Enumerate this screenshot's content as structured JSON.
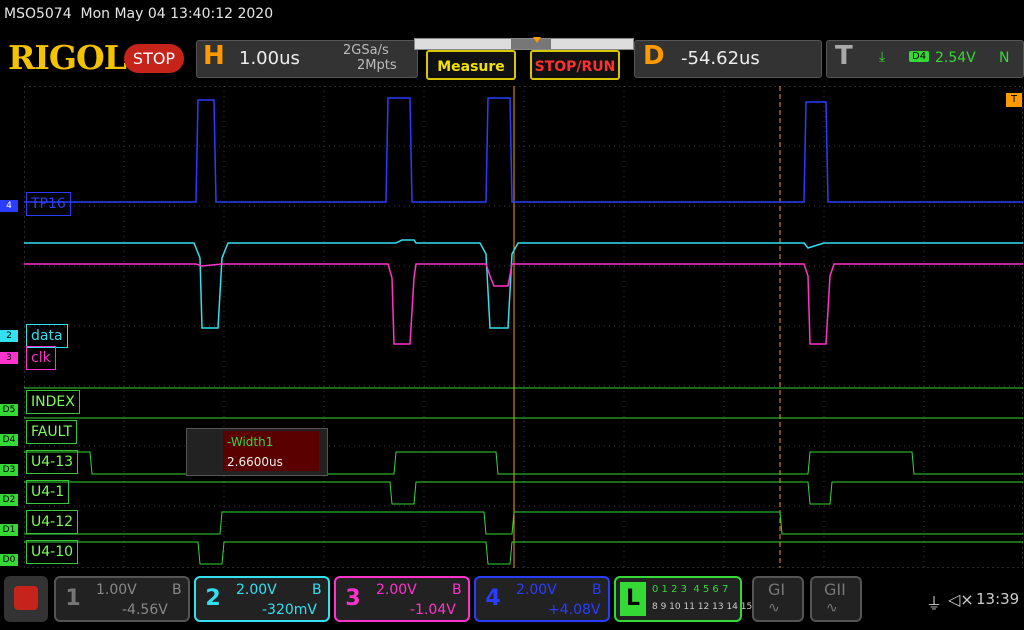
{
  "header": {
    "model_timestamp": "MSO5074  Mon May 04 13:40:12 2020",
    "logo": "RIGOL",
    "run_state": "STOP",
    "horizontal": {
      "letter": "H",
      "scale": "1.00us",
      "sample_rate": "2GSa/s",
      "memory": "2Mpts"
    },
    "measure_button": "Measure",
    "stoprun_button": "STOP/RUN",
    "delay": {
      "letter": "D",
      "value": "-54.62us"
    },
    "trigger": {
      "letter": "T",
      "source": "D4",
      "level": "2.54V",
      "mode": "N"
    }
  },
  "channel_labels": {
    "ch4": "TP16",
    "ch2": "data",
    "ch3": "clk",
    "d5": "INDEX",
    "d4": "FAULT",
    "d3": "U4-13",
    "d2": "U4-1",
    "d1": "U4-12",
    "d0": "U4-10"
  },
  "channel_markers": {
    "ch4": "4",
    "ch2": "2",
    "ch3": "3",
    "d5": "D5",
    "d4": "D4",
    "d3": "D3",
    "d2": "D2",
    "d1": "D1",
    "d0": "D0"
  },
  "trigger_marker": "T",
  "measurement": {
    "label": "-Width1",
    "value": "2.6600us"
  },
  "bottom": {
    "ch1": {
      "num": "1",
      "scale": "1.00V",
      "coupling": "B",
      "offset": "-4.56V"
    },
    "ch2": {
      "num": "2",
      "scale": "2.00V",
      "coupling": "B",
      "offset": "-320mV"
    },
    "ch3": {
      "num": "3",
      "scale": "2.00V",
      "coupling": "B",
      "offset": "-1.04V"
    },
    "ch4": {
      "num": "4",
      "scale": "2.00V",
      "coupling": "B",
      "offset": "+4.08V"
    },
    "logic": {
      "letter": "L",
      "row1": "0 1 2 3  4 5 6 7",
      "row2": "8 9 10 11 12 13 14 15"
    },
    "g1": "GI",
    "g2": "GII",
    "clock": "13:39"
  },
  "colors": {
    "ch1": "#f0f000",
    "ch2": "#33e0f0",
    "ch3": "#ff33cc",
    "ch4": "#2a3dff",
    "digital": "#35d935",
    "accent": "#ff9900"
  }
}
